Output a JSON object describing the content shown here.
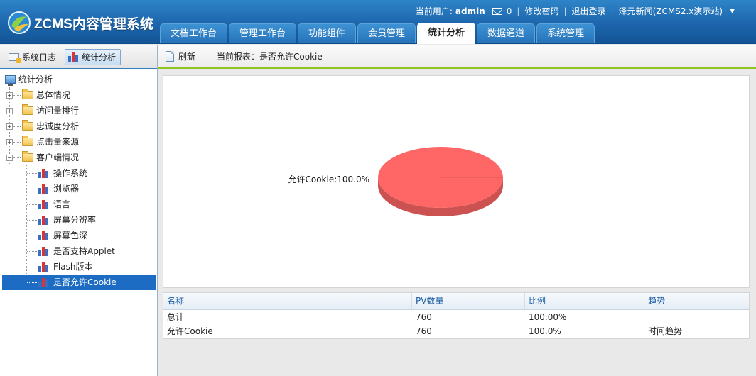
{
  "app": {
    "logo_text": "ZCMS内容管理系统"
  },
  "topbar": {
    "current_user_label": "当前用户:",
    "user": "admin",
    "mail_count": "0",
    "change_password": "修改密码",
    "logout": "退出登录",
    "site": "泽元新闻(ZCMS2.x演示站)"
  },
  "tabs": [
    {
      "label": "文档工作台"
    },
    {
      "label": "管理工作台"
    },
    {
      "label": "功能组件"
    },
    {
      "label": "会员管理"
    },
    {
      "label": "统计分析"
    },
    {
      "label": "数据通道"
    },
    {
      "label": "系统管理"
    }
  ],
  "active_tab_index": 4,
  "sidebar": {
    "tabs": [
      {
        "label": "系统日志",
        "icon": "envelope-icon"
      },
      {
        "label": "统计分析",
        "icon": "bar-chart-icon",
        "active": true
      }
    ],
    "tree": {
      "root": "统计分析",
      "folders": [
        {
          "label": "总体情况"
        },
        {
          "label": "访问量排行"
        },
        {
          "label": "忠诚度分析"
        },
        {
          "label": "点击量来源"
        },
        {
          "label": "客户端情况"
        }
      ],
      "leaves": [
        {
          "label": "操作系统"
        },
        {
          "label": "浏览器"
        },
        {
          "label": "语言"
        },
        {
          "label": "屏幕分辨率"
        },
        {
          "label": "屏幕色深"
        },
        {
          "label": "是否支持Applet"
        },
        {
          "label": "Flash版本"
        },
        {
          "label": "是否允许Cookie"
        }
      ],
      "selected_leaf": 7
    }
  },
  "toolbar": {
    "refresh": "刷新",
    "current_report": "当前报表：是否允许Cookie"
  },
  "chart_data": {
    "type": "pie",
    "slices": [
      {
        "label": "允许Cookie",
        "value": 100.0,
        "color": "#ff6666"
      }
    ],
    "slice_label": "允许Cookie:100.0%"
  },
  "table": {
    "columns": [
      "名称",
      "PV数量",
      "比例",
      "趋势"
    ],
    "rows": [
      {
        "name": "总计",
        "pv": "760",
        "ratio": "100.00%",
        "trend": ""
      },
      {
        "name": "允许Cookie",
        "pv": "760",
        "ratio": "100.0%",
        "trend": "时间趋势"
      }
    ]
  },
  "colors": {
    "header": "#1d66ad",
    "accent_green": "#8fc31f",
    "selection": "#1d6cc3",
    "link": "#1a5da6"
  }
}
